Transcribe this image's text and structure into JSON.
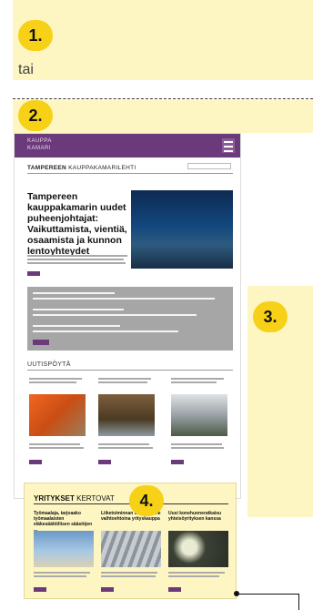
{
  "badges": [
    "1.",
    "2.",
    "3.",
    "4."
  ],
  "separator_text": "tai",
  "site": {
    "logo_line1": "KAUPPA",
    "logo_line2": "KAMARI",
    "title_bold": "TAMPEREEN",
    "title_rest": " KAUPPAKAMARILEHTI",
    "lead_headline": "Tampereen kauppakamarin uudet puheenjohtajat: Vaikuttamista, vientiä, osaamista ja kunnon lentoyhteydet",
    "section_news": "UUTISPÖYTÄ"
  },
  "companies": {
    "heading_bold": "YRITYKSET",
    "heading_rest": " KERTOVAT",
    "cards": [
      {
        "title": "Työmaalaja, tarjoaako työmaalaisten eläkesäätiöllisen säästöjen ..."
      },
      {
        "title": "Liiketoiminnan siirtämiselle vaihtoehtoina yrityskauppa"
      },
      {
        "title": "Uusi konehuoneratkaisu yhteisöyrityksen kanssa"
      }
    ]
  },
  "colors": {
    "accent_purple": "#6a3a7a",
    "highlight_yellow": "#fdf6c3",
    "badge_yellow": "#f7d117"
  }
}
